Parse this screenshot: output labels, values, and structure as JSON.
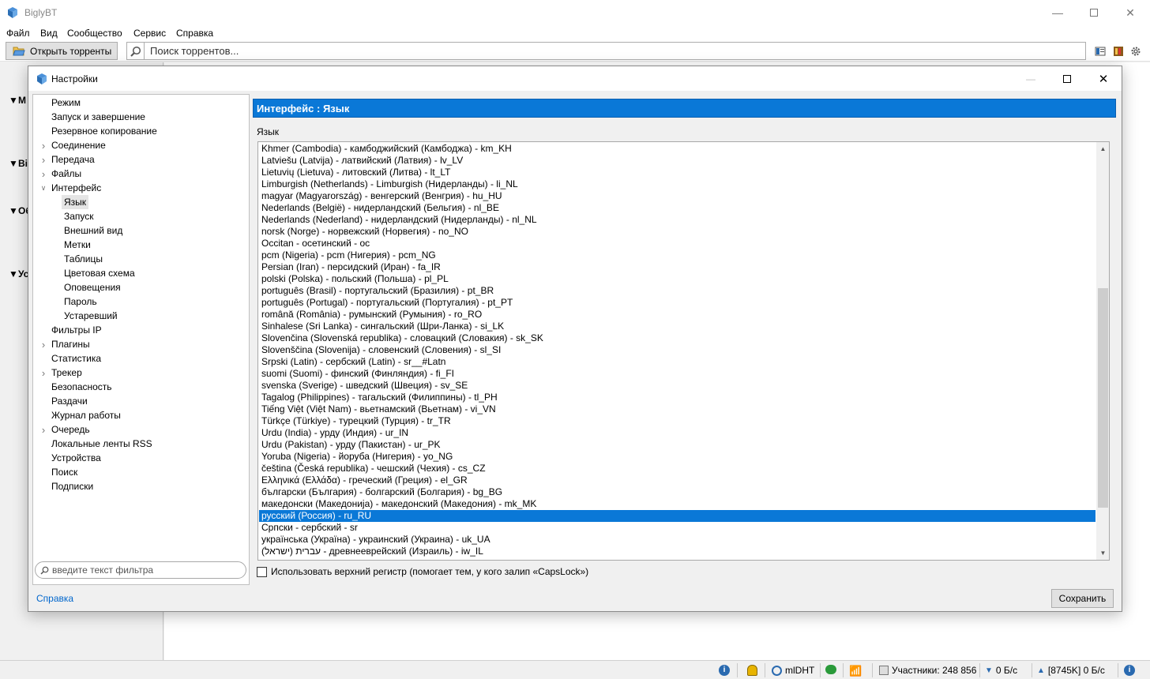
{
  "main_window": {
    "title": "BiglyBT",
    "menu": [
      "Файл",
      "Вид",
      "Сообщество",
      "Сервис",
      "Справка"
    ],
    "open_torrents_label": "Открыть торренты",
    "search_placeholder": "Поиск торрентов..."
  },
  "dialog": {
    "title": "Настройки",
    "tree": [
      {
        "label": "Режим",
        "level": 0,
        "expander": "none"
      },
      {
        "label": "Запуск и завершение",
        "level": 0,
        "expander": "none"
      },
      {
        "label": "Резервное копирование",
        "level": 0,
        "expander": "none"
      },
      {
        "label": "Соединение",
        "level": 0,
        "expander": "collapsed"
      },
      {
        "label": "Передача",
        "level": 0,
        "expander": "collapsed"
      },
      {
        "label": "Файлы",
        "level": 0,
        "expander": "collapsed"
      },
      {
        "label": "Интерфейс",
        "level": 0,
        "expander": "expanded"
      },
      {
        "label": "Язык",
        "level": 1,
        "expander": "none",
        "selected": true
      },
      {
        "label": "Запуск",
        "level": 1,
        "expander": "none"
      },
      {
        "label": "Внешний вид",
        "level": 1,
        "expander": "none"
      },
      {
        "label": "Метки",
        "level": 1,
        "expander": "none"
      },
      {
        "label": "Таблицы",
        "level": 1,
        "expander": "none"
      },
      {
        "label": "Цветовая схема",
        "level": 1,
        "expander": "none"
      },
      {
        "label": "Оповещения",
        "level": 1,
        "expander": "none"
      },
      {
        "label": "Пароль",
        "level": 1,
        "expander": "none"
      },
      {
        "label": "Устаревший",
        "level": 1,
        "expander": "none"
      },
      {
        "label": "Фильтры IP",
        "level": 0,
        "expander": "none"
      },
      {
        "label": "Плагины",
        "level": 0,
        "expander": "collapsed"
      },
      {
        "label": "Статистика",
        "level": 0,
        "expander": "none"
      },
      {
        "label": "Трекер",
        "level": 0,
        "expander": "collapsed"
      },
      {
        "label": "Безопасность",
        "level": 0,
        "expander": "none"
      },
      {
        "label": "Раздачи",
        "level": 0,
        "expander": "none"
      },
      {
        "label": "Журнал работы",
        "level": 0,
        "expander": "none"
      },
      {
        "label": "Очередь",
        "level": 0,
        "expander": "collapsed"
      },
      {
        "label": "Локальные ленты RSS",
        "level": 0,
        "expander": "none"
      },
      {
        "label": "Устройства",
        "level": 0,
        "expander": "none"
      },
      {
        "label": "Поиск",
        "level": 0,
        "expander": "none"
      },
      {
        "label": "Подписки",
        "level": 0,
        "expander": "none"
      }
    ],
    "filter_placeholder": "введите текст фильтра",
    "panel_header": "Интерфейс : Язык",
    "language_caption": "Язык",
    "languages": [
      "Khmer (Cambodia) - камбоджийский (Камбоджа) - km_KH",
      "Latviešu (Latvija) - латвийский (Латвия) - lv_LV",
      "Lietuvių (Lietuva) - литовский (Литва) - lt_LT",
      "Limburgish (Netherlands) - Limburgish (Нидерланды) - li_NL",
      "magyar (Magyarország) - венгерский (Венгрия) - hu_HU",
      "Nederlands (België) - нидерландский (Бельгия) - nl_BE",
      "Nederlands (Nederland) - нидерландский (Нидерланды) - nl_NL",
      "norsk (Norge) - норвежский (Норвегия) - no_NO",
      "Occitan - осетинский - oc",
      "pcm (Nigeria) - pcm (Нигерия) - pcm_NG",
      "Persian (Iran) - персидский (Иран) - fa_IR",
      "polski (Polska) - польский (Польша) - pl_PL",
      "português (Brasil) - португальский (Бразилия) - pt_BR",
      "português (Portugal) - португальский (Португалия) - pt_PT",
      "română (România) - румынский (Румыния) - ro_RO",
      "Sinhalese (Sri Lanka) - сингальский (Шри-Ланка) - si_LK",
      "Slovenčina (Slovenská republika) - словацкий (Словакия) - sk_SK",
      "Slovenščina (Slovenija) - словенский (Словения) - sl_SI",
      "Srpski (Latin) - сербский (Latin) - sr__#Latn",
      "suomi (Suomi) - финский (Финляндия) - fi_FI",
      "svenska (Sverige) - шведский (Швеция) - sv_SE",
      "Tagalog (Philippines) - тагальский (Филиппины) - tl_PH",
      "Tiếng Việt (Việt Nam) - вьетнамский (Вьетнам) - vi_VN",
      "Türkçe (Türkiye) - турецкий (Турция) - tr_TR",
      "Urdu (India) - урду (Индия) - ur_IN",
      "Urdu (Pakistan) - урду (Пакистан) - ur_PK",
      "Yoruba (Nigeria) - йоруба (Нигерия) - yo_NG",
      "čeština (Česká republika) - чешский (Чехия) - cs_CZ",
      "Ελληνικά (Ελλάδα) - греческий (Греция) - el_GR",
      "български (България) - болгарский (Болгария) - bg_BG",
      "македонски (Македонија) - македонский (Македония) - mk_MK",
      "русский (Россия) - ru_RU",
      "Српски - сербский - sr",
      "українська (Україна) - украинский (Украина) - uk_UA",
      "עברית (ישראל) - древнееврейский (Израиль) - iw_IL"
    ],
    "selected_language_index": 31,
    "caps_checkbox_label": "Использовать верхний регистр (помогает тем, у кого залип «CapsLock»)",
    "help_link": "Справка",
    "save_label": "Сохранить"
  },
  "background_sections": [
    {
      "label": "М"
    },
    {
      "label": "Bi"
    },
    {
      "label": "Об"
    },
    {
      "label": "Ус"
    }
  ],
  "statusbar": {
    "dht": "mlDHT",
    "participants": "Участники: 248 856",
    "down": "0 Б/с",
    "up": "[8745K] 0 Б/с"
  },
  "colors": {
    "accent": "#0a78d7",
    "link": "#0066cc"
  }
}
